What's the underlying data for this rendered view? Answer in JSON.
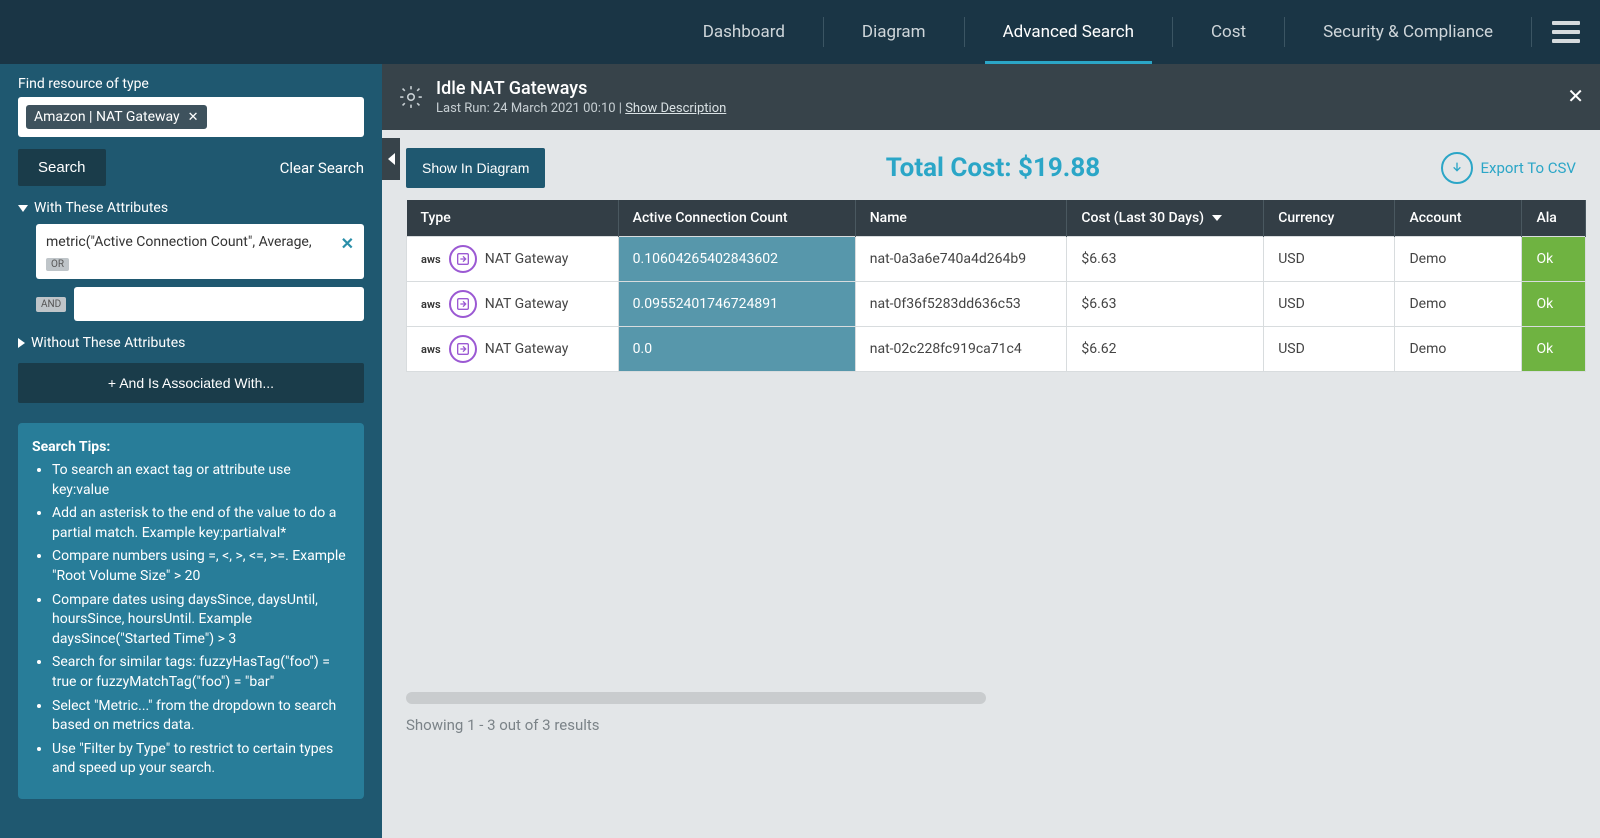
{
  "nav": {
    "tabs": [
      "Dashboard",
      "Diagram",
      "Advanced Search",
      "Cost",
      "Security & Compliance"
    ],
    "active_index": 2
  },
  "sidebar": {
    "find_label": "Find resource of type",
    "type_tag": "Amazon | NAT Gateway",
    "search_btn": "Search",
    "clear_search": "Clear Search",
    "with_attr_header": "With These Attributes",
    "attr_expression": "metric(\"Active Connection Count\", Average,",
    "or_label": "OR",
    "and_label": "AND",
    "and_input_value": "",
    "without_attr_header": "Without These Attributes",
    "assoc_btn": "+ And Is Associated With...",
    "tips_title": "Search Tips:",
    "tips": [
      "To search an exact tag or attribute use key:value",
      "Add an asterisk to the end of the value to do a partial match. Example key:partialval*",
      "Compare numbers using =, <, >, <=, >=. Example \"Root Volume Size\" > 20",
      "Compare dates using daysSince, daysUntil, hoursSince, hoursUntil. Example daysSince(\"Started Time\") > 3",
      "Search for similar tags: fuzzyHasTag(\"foo\") = true or fuzzyMatchTag(\"foo\") = \"bar\"",
      "Select \"Metric...\" from the dropdown to search based on metrics data.",
      "Use \"Filter by Type\" to restrict to certain types and speed up your search."
    ]
  },
  "header": {
    "title": "Idle NAT Gateways",
    "last_run_prefix": "Last Run: ",
    "last_run": "24 March 2021 00:10",
    "separator": " | ",
    "show_desc": "Show Description"
  },
  "actions": {
    "show_in_diagram": "Show In Diagram",
    "total_cost_label": "Total Cost: ",
    "total_cost_value": "$19.88",
    "export_csv": "Export To CSV"
  },
  "table": {
    "columns": [
      "Type",
      "Active Connection Count",
      "Name",
      "Cost (Last 30 Days)",
      "Currency",
      "Account",
      "Ala"
    ],
    "sorted_col_index": 3,
    "rows": [
      {
        "type": "NAT Gateway",
        "conn": "0.10604265402843602",
        "name": "nat-0a3a6e740a4d264b9",
        "cost": "$6.63",
        "currency": "USD",
        "account": "Demo",
        "alarm": "Ok"
      },
      {
        "type": "NAT Gateway",
        "conn": "0.09552401746724891",
        "name": "nat-0f36f5283dd636c53",
        "cost": "$6.63",
        "currency": "USD",
        "account": "Demo",
        "alarm": "Ok"
      },
      {
        "type": "NAT Gateway",
        "conn": "0.0",
        "name": "nat-02c228fc919ca71c4",
        "cost": "$6.62",
        "currency": "USD",
        "account": "Demo",
        "alarm": "Ok"
      }
    ]
  },
  "footer": {
    "results_text": "Showing 1 - 3 out of 3 results"
  }
}
